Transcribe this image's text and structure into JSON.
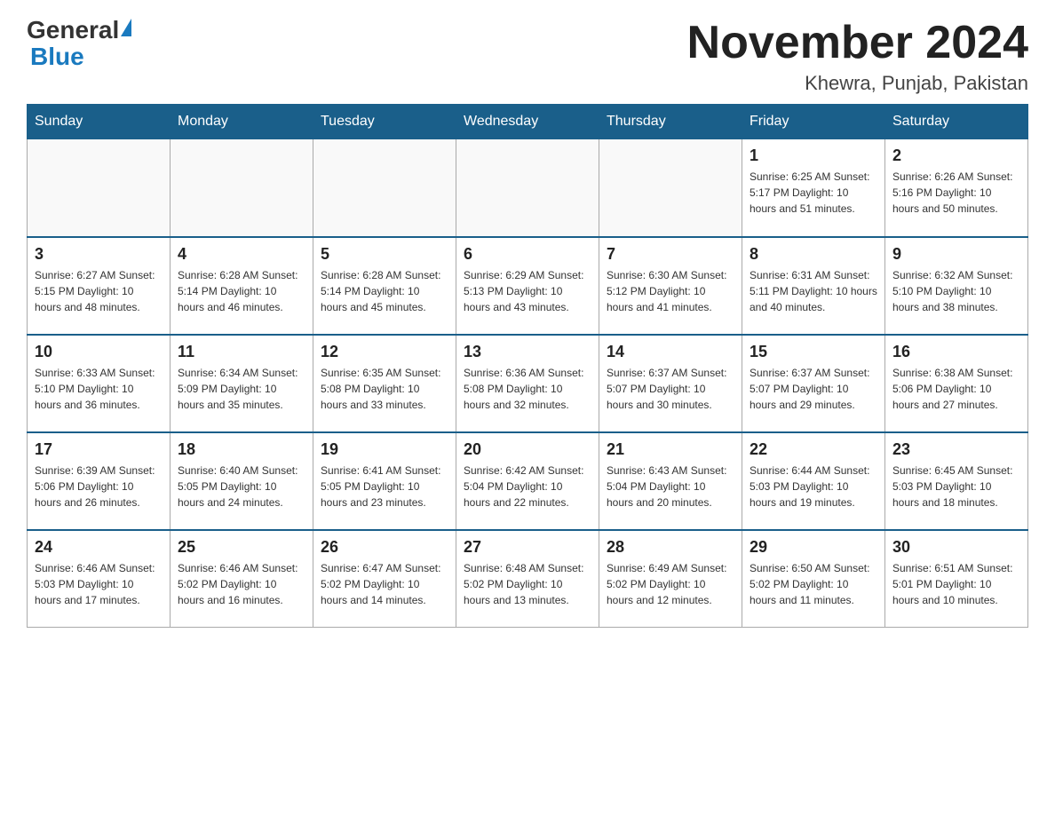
{
  "header": {
    "logo": {
      "general": "General",
      "blue": "Blue"
    },
    "title": "November 2024",
    "location": "Khewra, Punjab, Pakistan"
  },
  "weekdays": [
    "Sunday",
    "Monday",
    "Tuesday",
    "Wednesday",
    "Thursday",
    "Friday",
    "Saturday"
  ],
  "weeks": [
    [
      {
        "day": "",
        "info": ""
      },
      {
        "day": "",
        "info": ""
      },
      {
        "day": "",
        "info": ""
      },
      {
        "day": "",
        "info": ""
      },
      {
        "day": "",
        "info": ""
      },
      {
        "day": "1",
        "info": "Sunrise: 6:25 AM\nSunset: 5:17 PM\nDaylight: 10 hours and 51 minutes."
      },
      {
        "day": "2",
        "info": "Sunrise: 6:26 AM\nSunset: 5:16 PM\nDaylight: 10 hours and 50 minutes."
      }
    ],
    [
      {
        "day": "3",
        "info": "Sunrise: 6:27 AM\nSunset: 5:15 PM\nDaylight: 10 hours and 48 minutes."
      },
      {
        "day": "4",
        "info": "Sunrise: 6:28 AM\nSunset: 5:14 PM\nDaylight: 10 hours and 46 minutes."
      },
      {
        "day": "5",
        "info": "Sunrise: 6:28 AM\nSunset: 5:14 PM\nDaylight: 10 hours and 45 minutes."
      },
      {
        "day": "6",
        "info": "Sunrise: 6:29 AM\nSunset: 5:13 PM\nDaylight: 10 hours and 43 minutes."
      },
      {
        "day": "7",
        "info": "Sunrise: 6:30 AM\nSunset: 5:12 PM\nDaylight: 10 hours and 41 minutes."
      },
      {
        "day": "8",
        "info": "Sunrise: 6:31 AM\nSunset: 5:11 PM\nDaylight: 10 hours and 40 minutes."
      },
      {
        "day": "9",
        "info": "Sunrise: 6:32 AM\nSunset: 5:10 PM\nDaylight: 10 hours and 38 minutes."
      }
    ],
    [
      {
        "day": "10",
        "info": "Sunrise: 6:33 AM\nSunset: 5:10 PM\nDaylight: 10 hours and 36 minutes."
      },
      {
        "day": "11",
        "info": "Sunrise: 6:34 AM\nSunset: 5:09 PM\nDaylight: 10 hours and 35 minutes."
      },
      {
        "day": "12",
        "info": "Sunrise: 6:35 AM\nSunset: 5:08 PM\nDaylight: 10 hours and 33 minutes."
      },
      {
        "day": "13",
        "info": "Sunrise: 6:36 AM\nSunset: 5:08 PM\nDaylight: 10 hours and 32 minutes."
      },
      {
        "day": "14",
        "info": "Sunrise: 6:37 AM\nSunset: 5:07 PM\nDaylight: 10 hours and 30 minutes."
      },
      {
        "day": "15",
        "info": "Sunrise: 6:37 AM\nSunset: 5:07 PM\nDaylight: 10 hours and 29 minutes."
      },
      {
        "day": "16",
        "info": "Sunrise: 6:38 AM\nSunset: 5:06 PM\nDaylight: 10 hours and 27 minutes."
      }
    ],
    [
      {
        "day": "17",
        "info": "Sunrise: 6:39 AM\nSunset: 5:06 PM\nDaylight: 10 hours and 26 minutes."
      },
      {
        "day": "18",
        "info": "Sunrise: 6:40 AM\nSunset: 5:05 PM\nDaylight: 10 hours and 24 minutes."
      },
      {
        "day": "19",
        "info": "Sunrise: 6:41 AM\nSunset: 5:05 PM\nDaylight: 10 hours and 23 minutes."
      },
      {
        "day": "20",
        "info": "Sunrise: 6:42 AM\nSunset: 5:04 PM\nDaylight: 10 hours and 22 minutes."
      },
      {
        "day": "21",
        "info": "Sunrise: 6:43 AM\nSunset: 5:04 PM\nDaylight: 10 hours and 20 minutes."
      },
      {
        "day": "22",
        "info": "Sunrise: 6:44 AM\nSunset: 5:03 PM\nDaylight: 10 hours and 19 minutes."
      },
      {
        "day": "23",
        "info": "Sunrise: 6:45 AM\nSunset: 5:03 PM\nDaylight: 10 hours and 18 minutes."
      }
    ],
    [
      {
        "day": "24",
        "info": "Sunrise: 6:46 AM\nSunset: 5:03 PM\nDaylight: 10 hours and 17 minutes."
      },
      {
        "day": "25",
        "info": "Sunrise: 6:46 AM\nSunset: 5:02 PM\nDaylight: 10 hours and 16 minutes."
      },
      {
        "day": "26",
        "info": "Sunrise: 6:47 AM\nSunset: 5:02 PM\nDaylight: 10 hours and 14 minutes."
      },
      {
        "day": "27",
        "info": "Sunrise: 6:48 AM\nSunset: 5:02 PM\nDaylight: 10 hours and 13 minutes."
      },
      {
        "day": "28",
        "info": "Sunrise: 6:49 AM\nSunset: 5:02 PM\nDaylight: 10 hours and 12 minutes."
      },
      {
        "day": "29",
        "info": "Sunrise: 6:50 AM\nSunset: 5:02 PM\nDaylight: 10 hours and 11 minutes."
      },
      {
        "day": "30",
        "info": "Sunrise: 6:51 AM\nSunset: 5:01 PM\nDaylight: 10 hours and 10 minutes."
      }
    ]
  ]
}
